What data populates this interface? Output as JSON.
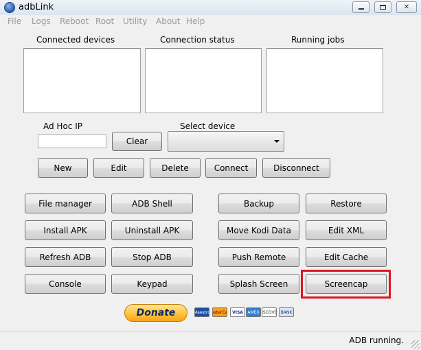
{
  "window": {
    "title": "adbLink"
  },
  "menu": [
    "File",
    "Logs",
    "Reboot",
    "Root",
    "Utility",
    "About",
    "Help"
  ],
  "panels": {
    "connected_devices": "Connected devices",
    "connection_status": "Connection status",
    "running_jobs": "Running jobs"
  },
  "adhoc": {
    "label": "Ad Hoc IP",
    "value": "",
    "clear": "Clear"
  },
  "device": {
    "label": "Select device",
    "selected": ""
  },
  "device_buttons": {
    "new": "New",
    "edit": "Edit",
    "delete": "Delete",
    "connect": "Connect",
    "disconnect": "Disconnect"
  },
  "actions": {
    "file_manager": "File manager",
    "adb_shell": "ADB Shell",
    "backup": "Backup",
    "restore": "Restore",
    "install_apk": "Install APK",
    "uninstall_apk": "Uninstall APK",
    "move_kodi_data": "Move Kodi Data",
    "edit_xml": "Edit XML",
    "refresh_adb": "Refresh ADB",
    "stop_adb": "Stop ADB",
    "push_remote": "Push Remote",
    "edit_cache": "Edit Cache",
    "console": "Console",
    "keypad": "Keypad",
    "splash_screen": "Splash Screen",
    "screencap": "Screencap"
  },
  "donate": {
    "label": "Donate",
    "cards": [
      "Maestro",
      "MasterCard",
      "VISA",
      "AMEX",
      "DISCOVER",
      "BANK"
    ]
  },
  "status": "ADB running.",
  "colors": {
    "highlight": "#e0141e",
    "donate_text": "#102a5c"
  }
}
